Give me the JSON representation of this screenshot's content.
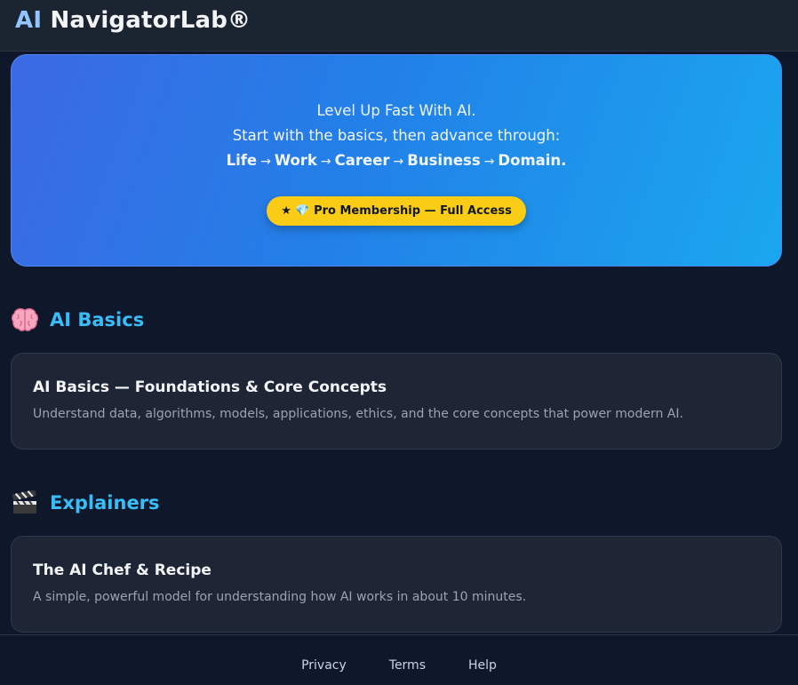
{
  "header": {
    "brand_ai": "AI",
    "brand_name": "NavigatorLab®"
  },
  "hero": {
    "line1": "Level Up Fast With AI.",
    "line2": "Start with the basics, then advance through:",
    "path": [
      "Life",
      "Work",
      "Career",
      "Business",
      "Domain."
    ],
    "arrow": "→",
    "cta_label": "★ 💎 Pro Membership — Full Access"
  },
  "sections": [
    {
      "icon": "brain-icon",
      "title": "AI Basics",
      "card": {
        "title": "AI Basics — Foundations & Core Concepts",
        "description": "Understand data, algorithms, models, applications, ethics, and the core concepts that power modern AI."
      }
    },
    {
      "icon": "clapperboard-icon",
      "title": "Explainers",
      "card": {
        "title": "The AI Chef & Recipe",
        "description": "A simple, powerful model for understanding how AI works in about 10 minutes."
      }
    }
  ],
  "footer": {
    "links": [
      "Privacy",
      "Terms",
      "Help"
    ]
  },
  "colors": {
    "accent": "#38bdf8",
    "cta": "#facc15",
    "background": "#0f172a"
  }
}
